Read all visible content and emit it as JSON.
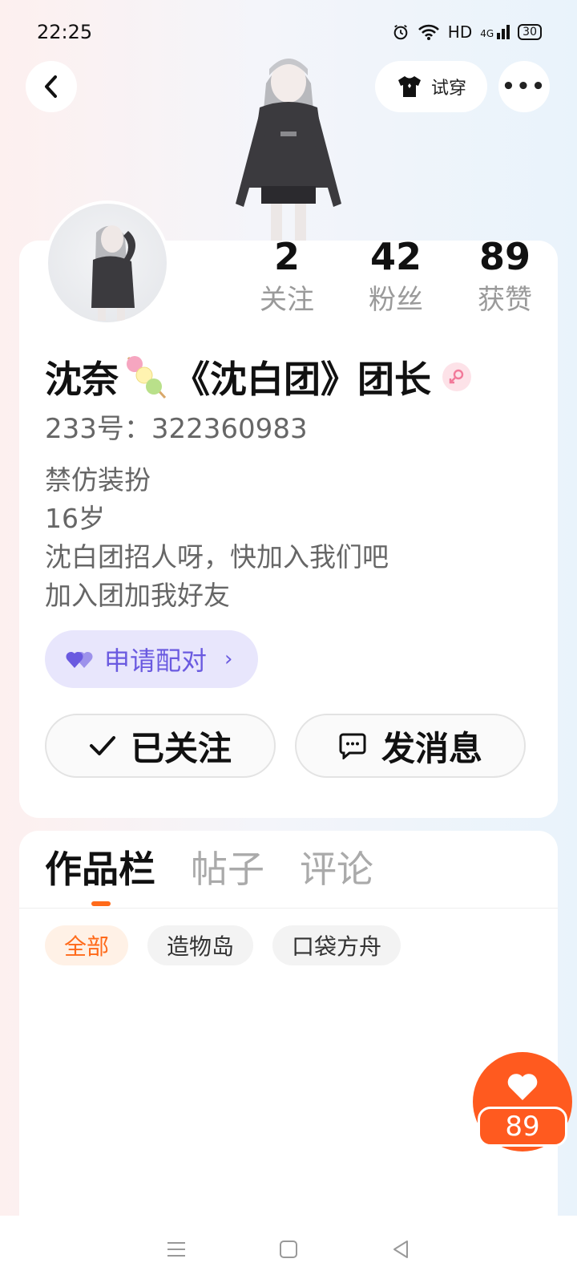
{
  "status_bar": {
    "time": "22:25",
    "network": "HD",
    "signal": "4G",
    "battery": "30"
  },
  "header": {
    "tryon_label": "试穿"
  },
  "stats": [
    {
      "value": "2",
      "label": "关注"
    },
    {
      "value": "42",
      "label": "粉丝"
    },
    {
      "value": "89",
      "label": "获赞"
    }
  ],
  "profile": {
    "name_first": "沈奈",
    "name_rest": "《沈白团》团长",
    "user_id": "233号：322360983",
    "bio": [
      "禁仿装扮",
      "16岁",
      "沈白团招人呀，快加入我们吧",
      "加入团加我好友"
    ]
  },
  "match_button": {
    "label": "申请配对"
  },
  "actions": {
    "follow_label": "已关注",
    "message_label": "发消息"
  },
  "tabs": [
    "作品栏",
    "帖子",
    "评论"
  ],
  "filters": [
    "全部",
    "造物岛",
    "口袋方舟"
  ],
  "like_fab": {
    "count": "89"
  },
  "colors": {
    "accent": "#ff5a1f",
    "match": "#6a5ae0",
    "match_bg": "#e8e6fc"
  }
}
